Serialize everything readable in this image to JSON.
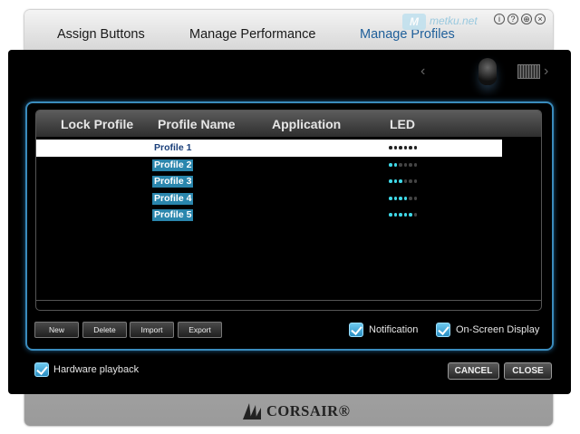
{
  "window": {
    "tabs": [
      {
        "label": "Assign Buttons",
        "active": false
      },
      {
        "label": "Manage Performance",
        "active": false
      },
      {
        "label": "Manage Profiles",
        "active": true
      }
    ],
    "watermark": {
      "logo": "M",
      "text": "metku.net"
    },
    "controls": [
      {
        "icon": "info-icon",
        "glyph": "i"
      },
      {
        "icon": "help-icon",
        "glyph": "?"
      },
      {
        "icon": "globe-icon",
        "glyph": "⊕"
      },
      {
        "icon": "close-icon",
        "glyph": "×"
      }
    ]
  },
  "device_nav": {
    "prev_glyph": "‹",
    "next_glyph": "›"
  },
  "table": {
    "headers": {
      "lock": "Lock Profile",
      "name": "Profile Name",
      "application": "Application",
      "led": "LED"
    },
    "rows": [
      {
        "name": "Profile 1",
        "application": "",
        "led_on": 1,
        "selected": true
      },
      {
        "name": "Profile 2",
        "application": "",
        "led_on": 2,
        "selected": false
      },
      {
        "name": "Profile 3",
        "application": "",
        "led_on": 3,
        "selected": false
      },
      {
        "name": "Profile 4",
        "application": "",
        "led_on": 4,
        "selected": false
      },
      {
        "name": "Profile 5",
        "application": "",
        "led_on": 5,
        "selected": false
      }
    ],
    "led_total": 6
  },
  "actions": {
    "new": "New",
    "delete": "Delete",
    "import": "Import",
    "export": "Export"
  },
  "options": {
    "notification": {
      "label": "Notification",
      "checked": true
    },
    "osd": {
      "label": "On-Screen Display",
      "checked": true
    },
    "hardware_playback": {
      "label": "Hardware playback",
      "checked": true
    }
  },
  "footer": {
    "cancel": "CANCEL",
    "close": "CLOSE"
  },
  "brand": {
    "text": "CORSAIR®"
  },
  "colors": {
    "accent": "#3a8bbc",
    "led_on": "#3fd9e8",
    "selected_row": "#ffffff",
    "profile_highlight": "#2a86ad"
  }
}
